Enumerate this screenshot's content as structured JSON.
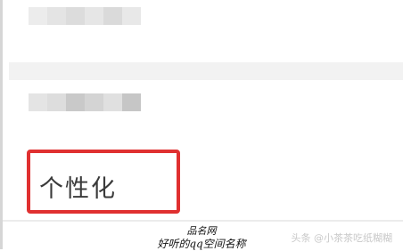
{
  "blurred_rows": {
    "top": [
      "#ececec",
      "#e4e4e4",
      "#dcdcdc",
      "#e6e6e6",
      "#dadada",
      "#e8e8e8"
    ],
    "middle": [
      "#e4e4e4",
      "#dddddd",
      "#c9c9c9",
      "#d4d4d4",
      "#e0e0e0",
      "#c6c6c6"
    ]
  },
  "menu": {
    "highlighted_item": "个性化",
    "highlight_color": "#e03030"
  },
  "caption": {
    "site": "品名网",
    "title": "好听的qq空间名称"
  },
  "watermark": "头条 @小茶茶吃纸糊糊"
}
